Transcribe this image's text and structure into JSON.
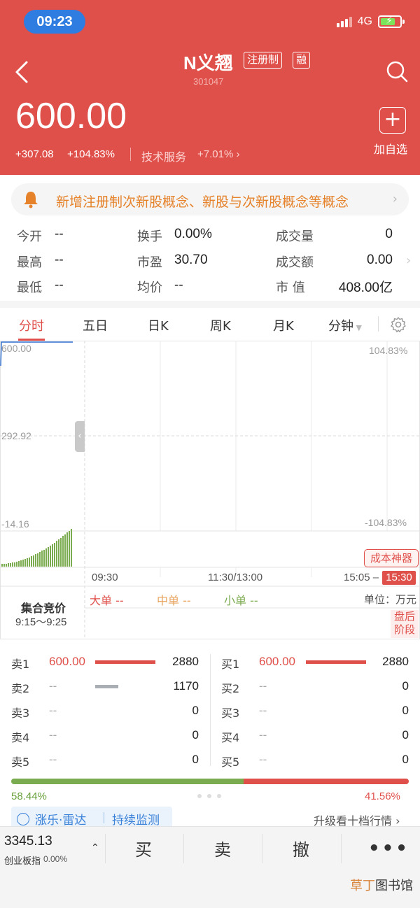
{
  "status_bar": {
    "time": "09:23",
    "network": "4G"
  },
  "header": {
    "stock_name": "N义翘",
    "tag_registration": "注册制",
    "tag_margin": "融",
    "stock_code": "301047",
    "price": "600.00",
    "change": "+307.08",
    "change_pct": "+104.83%",
    "sector": "技术服务",
    "sector_change": "+7.01%",
    "add_watchlist_label": "加自选"
  },
  "notice": {
    "text": "新增注册制次新股概念、新股与次新股概念等概念"
  },
  "stats": {
    "open_label": "今开",
    "open_value": "--",
    "high_label": "最高",
    "high_value": "--",
    "low_label": "最低",
    "low_value": "--",
    "turnover_label": "换手",
    "turnover_value": "0.00%",
    "pe_label": "市盈",
    "pe_value": "30.70",
    "avg_label": "均价",
    "avg_value": "--",
    "volume_label": "成交量",
    "volume_value": "0",
    "amount_label": "成交额",
    "amount_value": "0.00",
    "mktcap_label": "市 值",
    "mktcap_value": "408.00亿"
  },
  "tabs": [
    "分时",
    "五日",
    "日K",
    "周K",
    "月K",
    "分钟"
  ],
  "chart": {
    "price_top": "600.00",
    "price_mid": "292.92",
    "price_bottom": "-14.16",
    "pct_top": "104.83%",
    "pct_bottom": "-104.83%",
    "cost_tool_label": "成本神器",
    "time_open": "09:30",
    "time_mid": "11:30/13:00",
    "time_late": "15:05 –",
    "time_close": "15:30"
  },
  "auction": {
    "title": "集合竞价",
    "time": "9:15～9:25"
  },
  "flow": {
    "large_label": "大单",
    "large_value": "--",
    "mid_label": "中单",
    "mid_value": "--",
    "small_label": "小单",
    "small_value": "--",
    "unit": "单位：万元",
    "after_hours": "盘后阶段",
    "colors": {
      "large": "#e0504b",
      "mid": "#e9a35c",
      "small": "#7bab4f"
    }
  },
  "order_book": {
    "sell": [
      {
        "label": "卖1",
        "price": "600.00",
        "volume": "2880",
        "level": 1.0
      },
      {
        "label": "卖2",
        "price": "--",
        "volume": "1170",
        "level": 0.41
      },
      {
        "label": "卖3",
        "price": "--",
        "volume": "0",
        "level": 0
      },
      {
        "label": "卖4",
        "price": "--",
        "volume": "0",
        "level": 0
      },
      {
        "label": "卖5",
        "price": "--",
        "volume": "0",
        "level": 0
      }
    ],
    "buy": [
      {
        "label": "买1",
        "price": "600.00",
        "volume": "2880",
        "level": 1.0
      },
      {
        "label": "买2",
        "price": "--",
        "volume": "0",
        "level": 0
      },
      {
        "label": "买3",
        "price": "--",
        "volume": "0",
        "level": 0
      },
      {
        "label": "买4",
        "price": "--",
        "volume": "0",
        "level": 0
      },
      {
        "label": "买5",
        "price": "--",
        "volume": "0",
        "level": 0
      }
    ],
    "ratio_left": "58.44%",
    "ratio_right": "41.56%",
    "ratio_left_value": 0.5844
  },
  "monitor": {
    "label_1": "涨乐·雷达",
    "label_2": "持续监测",
    "upgrade": "升级看十档行情"
  },
  "bottom_bar": {
    "index_value": "3345.13",
    "index_name": "创业板指",
    "index_change": "0.00%",
    "buy": "买",
    "sell": "卖",
    "cancel": "撤",
    "more": "•••"
  },
  "watermark": {
    "part1": "草丁",
    "part2": "图书馆"
  },
  "colors": {
    "brand_red": "#e0504b",
    "green": "#7bab4f",
    "accent_blue": "#2f7de0",
    "orange": "#e5822a"
  }
}
